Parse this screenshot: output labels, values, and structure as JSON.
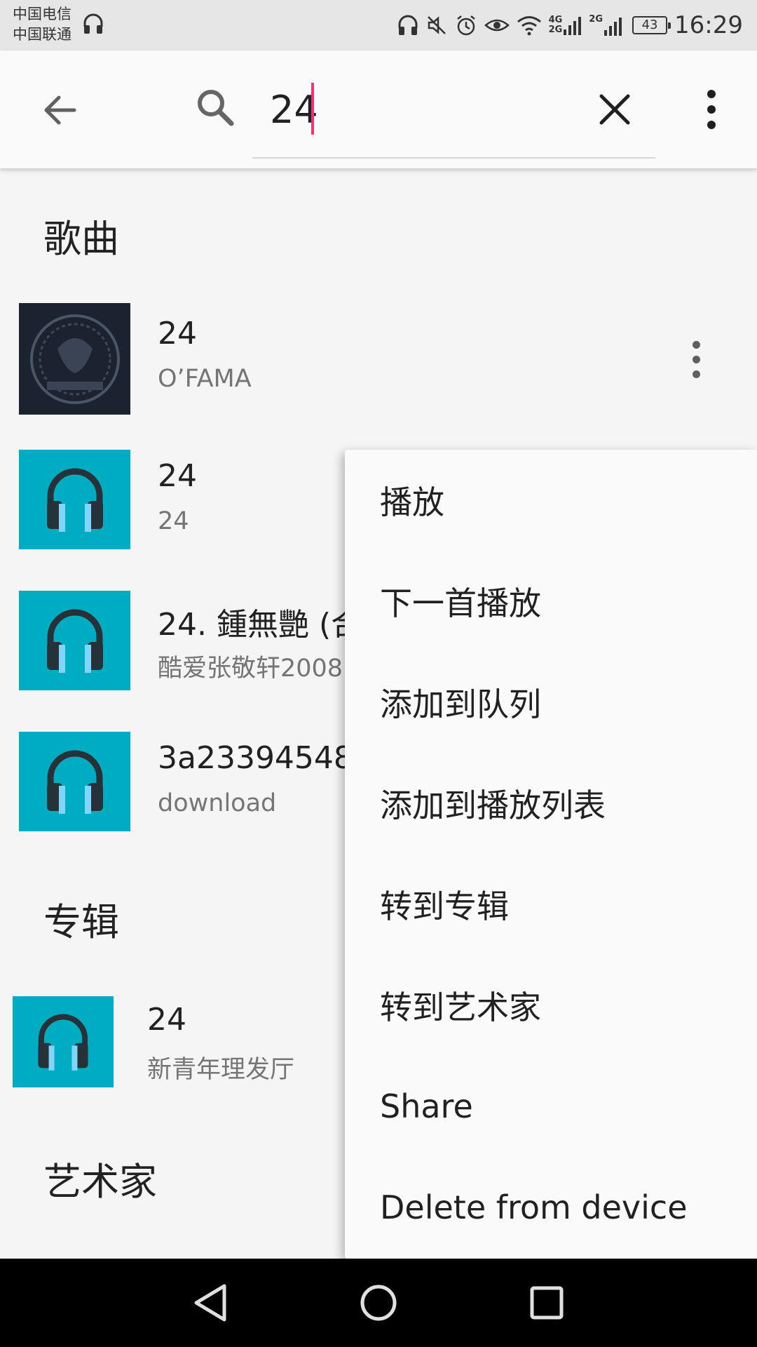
{
  "status_bar": {
    "carrier_1": "中国电信",
    "carrier_2": "中国联通",
    "network_1": "4G",
    "network_1b": "2G",
    "network_2": "2G",
    "battery": "43",
    "time": "16:29",
    "icons": [
      "headphone-icon",
      "headphone-icon",
      "mute-icon",
      "alarm-icon",
      "eye-icon",
      "wifi-icon",
      "signal-icon",
      "signal-icon",
      "battery-icon"
    ]
  },
  "search": {
    "query": "24",
    "back_icon": "arrow-left-icon",
    "search_icon": "search-icon",
    "clear_icon": "close-icon",
    "more_icon": "more-vert-icon"
  },
  "sections": {
    "songs": "歌曲",
    "albums": "专辑",
    "artists": "艺术家"
  },
  "songs": [
    {
      "title": "24",
      "subtitle": "O’FAMA",
      "art": "album-art-dark"
    },
    {
      "title": "24",
      "subtitle": "24",
      "art": "headphones-icon"
    },
    {
      "title": "24. 鍾無艷 (合",
      "subtitle": "酷爱张敬轩2008",
      "art": "headphones-icon"
    },
    {
      "title": "3a23394548",
      "subtitle": "download",
      "art": "headphones-icon"
    }
  ],
  "albums": [
    {
      "title": "24",
      "subtitle": "新青年理发厅",
      "art": "headphones-icon"
    }
  ],
  "menu": {
    "items": [
      "播放",
      "下一首播放",
      "添加到队列",
      "添加到播放列表",
      "转到专辑",
      "转到艺术家",
      "Share",
      "Delete from device"
    ]
  },
  "nav": {
    "back": "triangle-back-icon",
    "home": "circle-home-icon",
    "recents": "square-recents-icon"
  },
  "colors": {
    "accent_caret": "#ff2e75",
    "art_teal": "#00acc1"
  }
}
